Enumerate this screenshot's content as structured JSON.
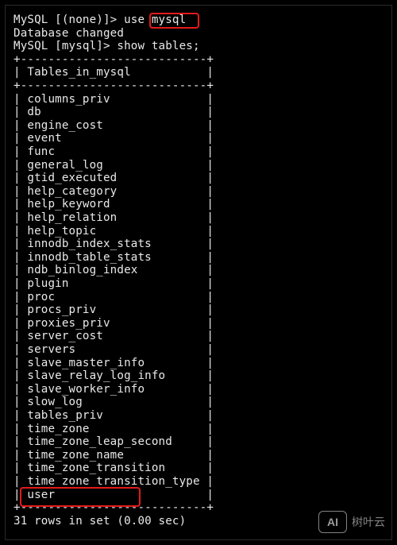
{
  "session": {
    "prompt_line_1": "MySQL [(none)]> use ",
    "use_arg": "mysql",
    "status_line": "Database changed",
    "prompt_line_2": "MySQL [mysql]> show tables;"
  },
  "table": {
    "border": "+---------------------------+",
    "header_row": "| Tables_in_mysql           |",
    "rows": [
      "| columns_priv              |",
      "| db                        |",
      "| engine_cost               |",
      "| event                     |",
      "| func                      |",
      "| general_log               |",
      "| gtid_executed             |",
      "| help_category             |",
      "| help_keyword              |",
      "| help_relation             |",
      "| help_topic                |",
      "| innodb_index_stats        |",
      "| innodb_table_stats        |",
      "| ndb_binlog_index          |",
      "| plugin                    |",
      "| proc                      |",
      "| procs_priv                |",
      "| proxies_priv              |",
      "| server_cost               |",
      "| servers                   |",
      "| slave_master_info         |",
      "| slave_relay_log_info      |",
      "| slave_worker_info         |",
      "| slow_log                  |",
      "| tables_priv               |",
      "| time_zone                 |",
      "| time_zone_leap_second     |",
      "| time_zone_name            |",
      "| time_zone_transition      |",
      "| time_zone_transition_type |",
      "| user                      |"
    ]
  },
  "result_line": "31 rows in set (0.00 sec)",
  "watermark": {
    "logo_text": "AI",
    "site_text": "树叶云"
  },
  "colors": {
    "terminal_bg": "#000000",
    "text": "#e9e9e9",
    "highlight": "#e31a1a"
  }
}
